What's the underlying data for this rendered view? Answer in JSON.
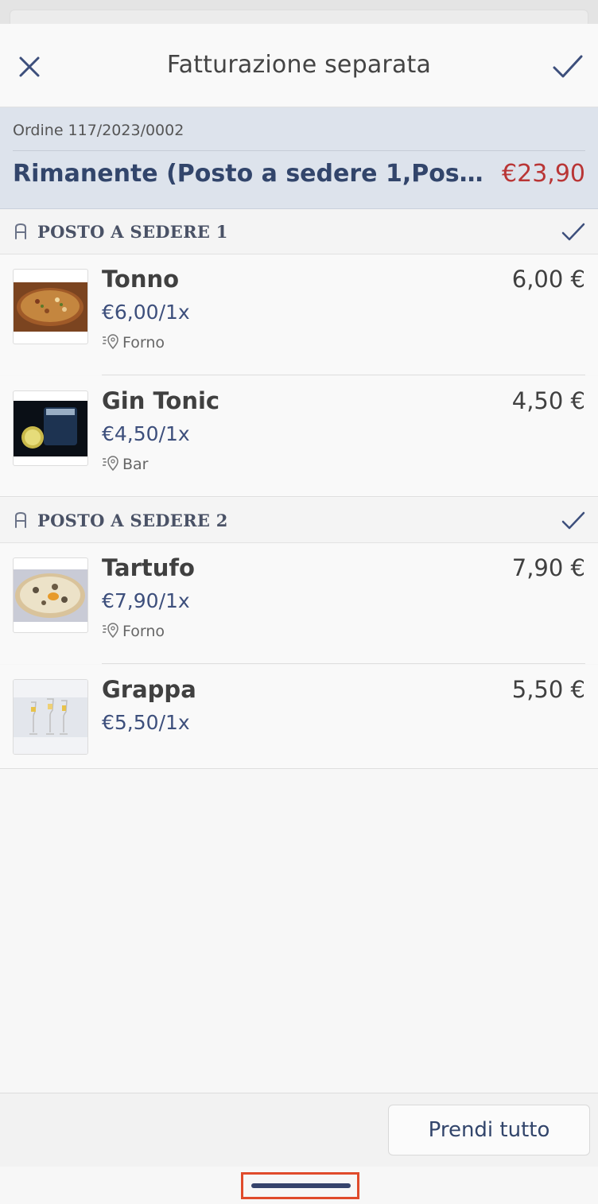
{
  "header": {
    "title": "Fatturazione separata",
    "close_icon": "close-icon",
    "confirm_icon": "check-icon"
  },
  "order": {
    "number": "Ordine 117/2023/0002",
    "remaining_label": "Rimanente (Posto a sedere 1,Posto a sedere 2)",
    "remaining_total": "€23,90"
  },
  "seats": [
    {
      "label": "POSTO A SEDERE 1",
      "icon": "seat-icon",
      "items": [
        {
          "name": "Tonno",
          "unit_price": "€6,00/1x",
          "station": "Forno",
          "price": "6,00 €",
          "image": "pizza-tonno-image"
        },
        {
          "name": "Gin Tonic",
          "unit_price": "€4,50/1x",
          "station": "Bar",
          "price": "4,50 €",
          "image": "gin-tonic-image"
        }
      ]
    },
    {
      "label": "POSTO A SEDERE 2",
      "icon": "seat-icon",
      "items": [
        {
          "name": "Tartufo",
          "unit_price": "€7,90/1x",
          "station": "Forno",
          "price": "7,90 €",
          "image": "pizza-tartufo-image"
        },
        {
          "name": "Grappa",
          "unit_price": "€5,50/1x",
          "station": "",
          "price": "5,50 €",
          "image": "grappa-image"
        }
      ]
    }
  ],
  "footer": {
    "take_all_label": "Prendi tutto"
  },
  "colors": {
    "accent": "#32456b",
    "total_red": "#b93535",
    "highlight": "#e04b2b"
  }
}
